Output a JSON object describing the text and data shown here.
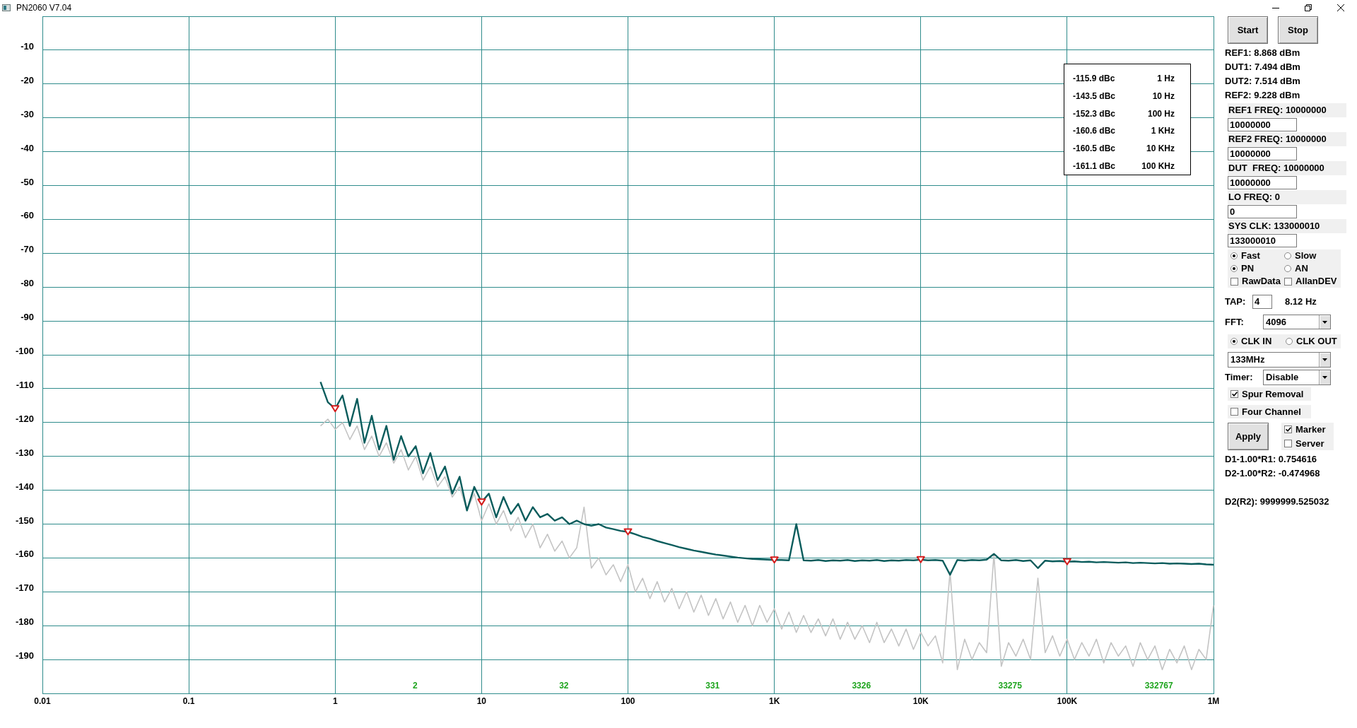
{
  "window": {
    "title": "PN2060 V7.04"
  },
  "chart": {
    "chart_data": {
      "type": "line",
      "categories": [
        "0.01",
        null,
        null,
        null,
        null,
        null,
        null,
        null,
        null,
        null,
        null,
        null,
        null,
        null,
        null,
        null,
        null,
        null,
        null,
        null,
        "0.1",
        null,
        null,
        null,
        null,
        null,
        null,
        null,
        null,
        null,
        null,
        null,
        null,
        null,
        null,
        null,
        null,
        null,
        null,
        null,
        "1",
        null,
        null,
        null,
        null,
        null,
        null,
        null,
        null,
        null,
        null,
        null,
        null,
        null,
        null,
        null,
        null,
        null,
        null,
        null,
        "10",
        null,
        null,
        null,
        null,
        null,
        null,
        null,
        null,
        null,
        null,
        null,
        null,
        null,
        null,
        null,
        null,
        null,
        null,
        null,
        "100",
        null,
        null,
        null,
        null,
        null,
        null,
        null,
        null,
        null,
        null,
        null,
        null,
        null,
        null,
        null,
        null,
        null,
        null,
        null,
        "1K",
        null,
        null,
        null,
        null,
        null,
        null,
        null,
        null,
        null,
        null,
        null,
        null,
        null,
        null,
        null,
        null,
        null,
        null,
        null,
        "10K",
        null,
        null,
        null,
        null,
        null,
        null,
        null,
        null,
        null,
        null,
        null,
        null,
        null,
        null,
        null,
        null,
        null,
        null,
        null,
        "100K",
        null,
        null,
        null,
        null,
        null,
        null,
        null,
        null,
        null,
        null,
        null,
        null,
        null,
        null,
        null,
        null,
        null,
        null,
        null,
        "1M"
      ],
      "series": [
        {
          "color": "#c4c4c4",
          "values": [
            null,
            null,
            null,
            null,
            null,
            null,
            null,
            null,
            null,
            null,
            null,
            null,
            null,
            null,
            null,
            null,
            null,
            null,
            null,
            null,
            null,
            null,
            null,
            null,
            null,
            null,
            null,
            null,
            null,
            null,
            null,
            null,
            null,
            null,
            null,
            null,
            null,
            null,
            -121,
            -119,
            -122,
            -120,
            -125,
            -121,
            -128,
            -124,
            -130,
            -126,
            -132,
            -128,
            -134,
            -130,
            -137,
            -133,
            -139,
            -136,
            -142,
            -139,
            -146,
            -141,
            -149,
            -144,
            -150,
            -146,
            -152,
            -148,
            -154,
            -150,
            -157,
            -153,
            -158,
            -155,
            -160,
            -157,
            -145,
            -163,
            -160,
            -165,
            -162,
            -167,
            -162,
            -170,
            -166,
            -172,
            -167,
            -173,
            -169,
            -175,
            -170,
            -176,
            -171,
            -177,
            -172,
            -178,
            -173,
            -179,
            -174,
            -180,
            -174,
            -179,
            -175,
            -181,
            -176,
            -182,
            -177,
            -182,
            -178,
            -183,
            -178,
            -184,
            -179,
            -184,
            -180,
            -185,
            -179,
            -185,
            -181,
            -186,
            -181,
            -187,
            -182,
            -186,
            -183,
            -191,
            -164,
            -193,
            -184,
            -190,
            -185,
            -188,
            -159,
            -192,
            -185,
            -189,
            -184,
            -190,
            -166,
            -188,
            -183,
            -189,
            -184,
            -190,
            -185,
            -189,
            -184,
            -191,
            -185,
            -189,
            -186,
            -192,
            -185,
            -190,
            -186,
            -193,
            -187,
            -191,
            -186,
            -193,
            -187,
            -190,
            -174
          ]
        },
        {
          "color": "#0a5c5c",
          "values": [
            null,
            null,
            null,
            null,
            null,
            null,
            null,
            null,
            null,
            null,
            null,
            null,
            null,
            null,
            null,
            null,
            null,
            null,
            null,
            null,
            null,
            null,
            null,
            null,
            null,
            null,
            null,
            null,
            null,
            null,
            null,
            null,
            null,
            null,
            null,
            null,
            null,
            null,
            -108,
            -114,
            -115.9,
            -112,
            -121,
            -113,
            -126,
            -118,
            -128,
            -121,
            -131,
            -124,
            -130,
            -127,
            -135,
            -129,
            -137,
            -133,
            -141,
            -136,
            -146,
            -139,
            -143.5,
            -141,
            -148,
            -142,
            -147,
            -144,
            -149,
            -145,
            -148,
            -147,
            -149,
            -148,
            -150,
            -149,
            -150,
            -150.5,
            -150,
            -151,
            -151.5,
            -152,
            -152.3,
            -153,
            -153.8,
            -154.3,
            -155,
            -155.6,
            -156.2,
            -156.8,
            -157.3,
            -157.8,
            -158.2,
            -158.6,
            -159,
            -159.3,
            -159.6,
            -159.9,
            -160.1,
            -160.3,
            -160.4,
            -160.5,
            -160.6,
            -160.6,
            -160.7,
            -150,
            -160.7,
            -160.8,
            -160.6,
            -160.9,
            -160.7,
            -160.8,
            -160.6,
            -160.9,
            -160.7,
            -160.8,
            -160.6,
            -160.9,
            -160.7,
            -160.8,
            -160.6,
            -160.7,
            -160.5,
            -160.7,
            -160.6,
            -160.8,
            -165,
            -160.6,
            -160.8,
            -160.6,
            -160.7,
            -160.5,
            -158.8,
            -160.7,
            -160.8,
            -160.6,
            -160.9,
            -160.7,
            -163,
            -160.8,
            -161,
            -160.9,
            -161.1,
            -161,
            -161.2,
            -161.1,
            -161.3,
            -161.2,
            -161.3,
            -161.4,
            -161.3,
            -161.5,
            -161.4,
            -161.5,
            -161.6,
            -161.5,
            -161.7,
            -161.6,
            -161.7,
            -161.8,
            -161.7,
            -161.9,
            -162
          ]
        }
      ],
      "ylim": [
        -200,
        0
      ],
      "yticks": [
        {
          "value": -10,
          "label": "-10"
        },
        {
          "value": -20,
          "label": "-20"
        },
        {
          "value": -30,
          "label": "-30"
        },
        {
          "value": -40,
          "label": "-40"
        },
        {
          "value": -50,
          "label": "-50"
        },
        {
          "value": -60,
          "label": "-60"
        },
        {
          "value": -70,
          "label": "-70"
        },
        {
          "value": -80,
          "label": "-80"
        },
        {
          "value": -90,
          "label": "-90"
        },
        {
          "value": -100,
          "label": "-100"
        },
        {
          "value": -110,
          "label": "-110"
        },
        {
          "value": -120,
          "label": "-120"
        },
        {
          "value": -130,
          "label": "-130"
        },
        {
          "value": -140,
          "label": "-140"
        },
        {
          "value": -150,
          "label": "-150"
        },
        {
          "value": -160,
          "label": "-160"
        },
        {
          "value": -170,
          "label": "-170"
        },
        {
          "value": -180,
          "label": "-180"
        },
        {
          "value": -190,
          "label": "-190"
        }
      ],
      "grid": true
    },
    "decade_counts": [
      "2",
      "32",
      "331",
      "3326",
      "33275",
      "332767"
    ]
  },
  "marker_table": [
    {
      "phase_noise": "-115.9 dBc",
      "offset": "1 Hz"
    },
    {
      "phase_noise": "-143.5 dBc",
      "offset": "10 Hz"
    },
    {
      "phase_noise": "-152.3 dBc",
      "offset": "100 Hz"
    },
    {
      "phase_noise": "-160.6 dBc",
      "offset": "1 KHz"
    },
    {
      "phase_noise": "-160.5 dBc",
      "offset": "10 KHz"
    },
    {
      "phase_noise": "-161.1 dBc",
      "offset": "100 KHz"
    }
  ],
  "controls": {
    "run_buttons": [
      {
        "label": "Start"
      },
      {
        "label": "Stop"
      }
    ],
    "readings": [
      "REF1: 8.868 dBm",
      "DUT1: 7.494 dBm",
      "DUT2: 7.514 dBm",
      "REF2: 9.228 dBm"
    ],
    "frequency_fields": [
      {
        "label": "REF1 FREQ: 10000000",
        "value": "10000000"
      },
      {
        "label": "REF2 FREQ: 10000000",
        "value": "10000000"
      },
      {
        "label": "DUT  FREQ: 10000000",
        "value": "10000000"
      },
      {
        "label": "LO FREQ: 0",
        "value": "0"
      },
      {
        "label": "SYS CLK: 133000010",
        "value": "133000010"
      }
    ],
    "mode_rows": [
      {
        "options": [
          {
            "kind": "radio",
            "label": "Fast",
            "selected": true
          },
          {
            "kind": "radio",
            "label": "Slow",
            "selected": false
          }
        ]
      },
      {
        "options": [
          {
            "kind": "radio",
            "label": "PN",
            "selected": true
          },
          {
            "kind": "radio",
            "label": "AN",
            "selected": false
          }
        ]
      },
      {
        "options": [
          {
            "kind": "checkbox",
            "label": "RawData",
            "checked": false
          },
          {
            "kind": "checkbox",
            "label": "AllanDEV",
            "checked": false
          }
        ]
      }
    ],
    "tap": {
      "label": "TAP:",
      "value": "4",
      "reading": "8.12 Hz"
    },
    "fft": {
      "label": "FFT:",
      "value": "4096"
    },
    "clock_options": [
      {
        "label": "CLK IN",
        "selected": true
      },
      {
        "label": "CLK OUT",
        "selected": false
      }
    ],
    "clock_rate": {
      "value": "133MHz"
    },
    "timer": {
      "label": "Timer:",
      "value": "Disable"
    },
    "options": [
      {
        "label": "Spur Removal",
        "checked": true
      },
      {
        "label": "Four Channel",
        "checked": false
      }
    ],
    "apply_button": {
      "label": "Apply"
    },
    "display_options": [
      {
        "label": "Marker",
        "checked": true
      },
      {
        "label": "Server",
        "checked": false
      }
    ],
    "differences": [
      "D1-1.00*R1: 0.754616",
      "D2-1.00*R2: -0.474968"
    ],
    "frequency_result": "D2(R2): 9999999.525032"
  }
}
